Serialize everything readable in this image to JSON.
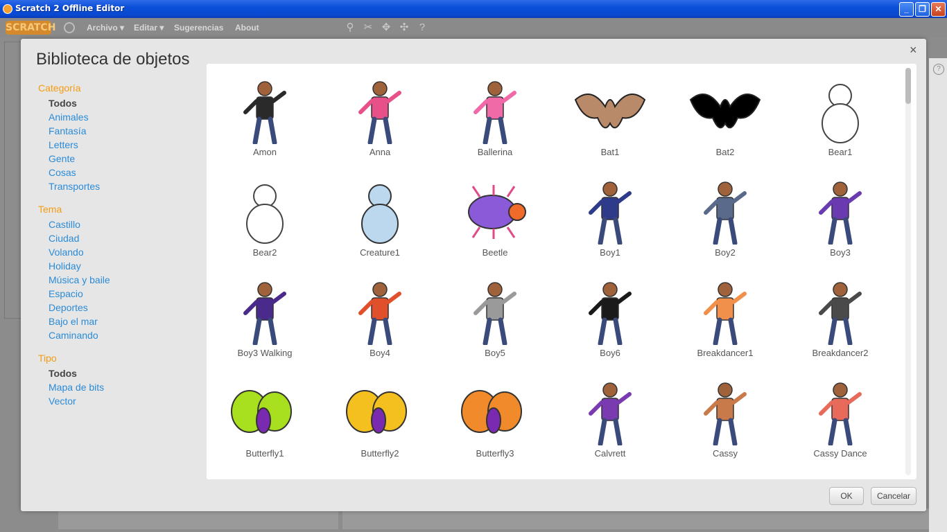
{
  "window": {
    "title": "Scratch 2 Offline Editor",
    "minimize": "_",
    "maximize": "❐",
    "close": "✕"
  },
  "menubar": {
    "logo": "SCRATCH",
    "items": [
      "Archivo ▾",
      "Editar ▾",
      "Sugerencias",
      "About"
    ]
  },
  "toolbar_icons": [
    "duplicate-stamp-icon",
    "cut-icon",
    "grow-icon",
    "shrink-icon",
    "help-icon"
  ],
  "dialog": {
    "title": "Biblioteca de objetos",
    "close": "×",
    "ok": "OK",
    "cancel": "Cancelar"
  },
  "filters": {
    "categoria": {
      "title": "Categoría",
      "items": [
        "Todos",
        "Animales",
        "Fantasía",
        "Letters",
        "Gente",
        "Cosas",
        "Transportes"
      ],
      "selected": "Todos"
    },
    "tema": {
      "title": "Tema",
      "items": [
        "Castillo",
        "Ciudad",
        "Volando",
        "Holiday",
        "Música y baile",
        "Espacio",
        "Deportes",
        "Bajo el mar",
        "Caminando"
      ]
    },
    "tipo": {
      "title": "Tipo",
      "items": [
        "Todos",
        "Mapa de bits",
        "Vector"
      ],
      "selected": "Todos"
    }
  },
  "sprites": [
    {
      "name": "Amon",
      "color": "#2a2a2a"
    },
    {
      "name": "Anna",
      "color": "#e8508a"
    },
    {
      "name": "Ballerina",
      "color": "#f06aa8"
    },
    {
      "name": "Bat1",
      "color": "#b88a6a"
    },
    {
      "name": "Bat2",
      "color": "#000000"
    },
    {
      "name": "Bear1",
      "color": "#ffffff"
    },
    {
      "name": "Bear2",
      "color": "#ffffff"
    },
    {
      "name": "Creature1",
      "color": "#bcd8ee"
    },
    {
      "name": "Beetle",
      "color": "#8a5ad8"
    },
    {
      "name": "Boy1",
      "color": "#2e3a8a"
    },
    {
      "name": "Boy2",
      "color": "#5a6a8a"
    },
    {
      "name": "Boy3",
      "color": "#6a3ab0"
    },
    {
      "name": "Boy3 Walking",
      "color": "#4a2a8a"
    },
    {
      "name": "Boy4",
      "color": "#e0502a"
    },
    {
      "name": "Boy5",
      "color": "#9a9a9a"
    },
    {
      "name": "Boy6",
      "color": "#1a1a1a"
    },
    {
      "name": "Breakdancer1",
      "color": "#f0904a"
    },
    {
      "name": "Breakdancer2",
      "color": "#4a4a4a"
    },
    {
      "name": "Butterfly1",
      "color": "#a8e020"
    },
    {
      "name": "Butterfly2",
      "color": "#f4c020"
    },
    {
      "name": "Butterfly3",
      "color": "#f08a2a"
    },
    {
      "name": "Calvrett",
      "color": "#7a3ab0"
    },
    {
      "name": "Cassy",
      "color": "#c87a4a"
    },
    {
      "name": "Cassy Dance",
      "color": "#e86a5a"
    }
  ]
}
